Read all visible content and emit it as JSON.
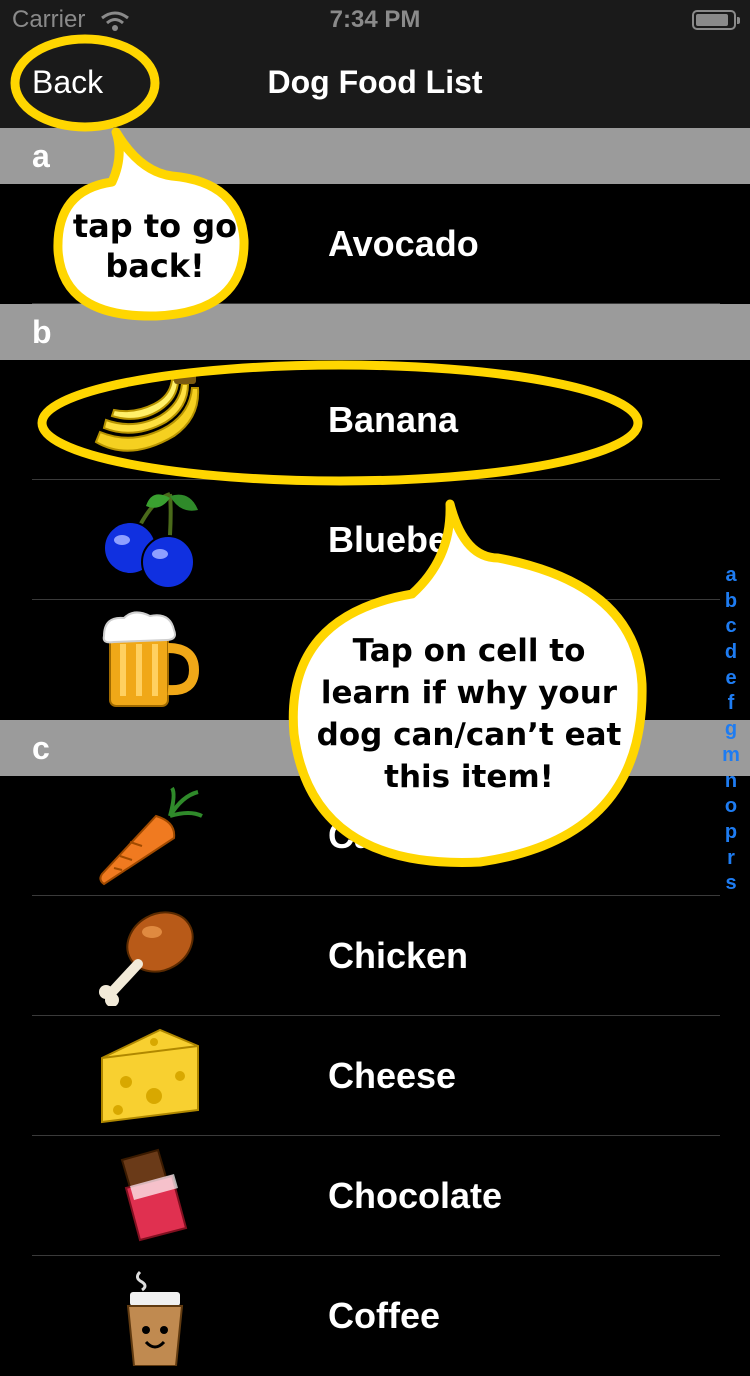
{
  "status_bar": {
    "carrier": "Carrier",
    "time": "7:34 PM"
  },
  "nav": {
    "back_label": "Back",
    "title": "Dog Food List"
  },
  "sections": [
    {
      "header": "a",
      "rows": [
        {
          "label": "Avocado",
          "icon": "avocado-icon"
        }
      ]
    },
    {
      "header": "b",
      "rows": [
        {
          "label": "Banana",
          "icon": "banana-icon"
        },
        {
          "label": "Bluebe",
          "icon": "blueberry-icon"
        },
        {
          "label": "",
          "icon": "beer-icon"
        }
      ]
    },
    {
      "header": "c",
      "rows": [
        {
          "label": "Carro",
          "icon": "carrot-icon"
        },
        {
          "label": "Chicken",
          "icon": "chicken-icon"
        },
        {
          "label": "Cheese",
          "icon": "cheese-icon"
        },
        {
          "label": "Chocolate",
          "icon": "chocolate-icon"
        },
        {
          "label": "Coffee",
          "icon": "coffee-icon"
        }
      ]
    }
  ],
  "index": [
    "a",
    "b",
    "c",
    "d",
    "e",
    "f",
    "g",
    "m",
    "n",
    "o",
    "p",
    "r",
    "s"
  ],
  "callouts": {
    "back_hint": [
      "tap to go",
      "back!"
    ],
    "cell_hint": [
      "Tap on cell to",
      "learn if why your",
      "dog can/can’t eat",
      "this item!"
    ]
  },
  "colors": {
    "highlight": "#ffd600",
    "index_accent": "#1e7cf2",
    "section_header": "#9b9b9b",
    "bar_background": "#1a1a1a"
  }
}
